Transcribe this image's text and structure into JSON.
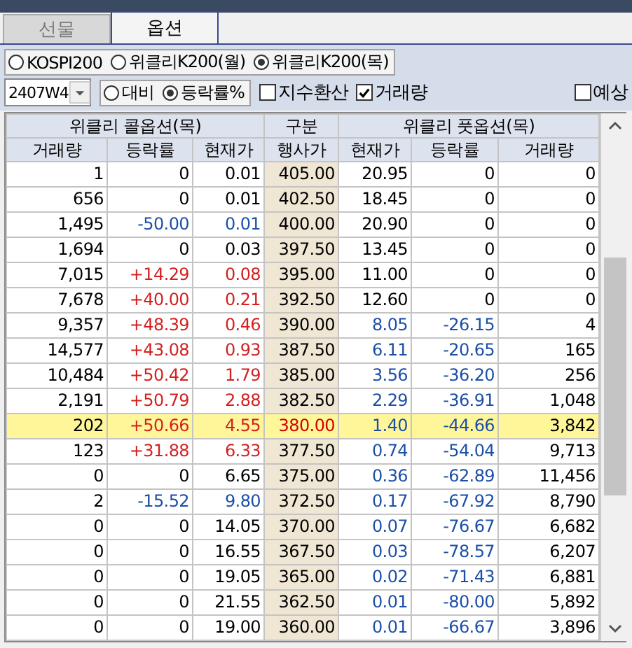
{
  "tabs": [
    {
      "label": "선물",
      "selected": false
    },
    {
      "label": "옵션",
      "selected": true
    }
  ],
  "markets": [
    {
      "label": "KOSPI200",
      "selected": false
    },
    {
      "label": "위클리K200(월)",
      "selected": false
    },
    {
      "label": "위클리K200(목)",
      "selected": true
    }
  ],
  "expiry": {
    "value": "2407W4"
  },
  "display_modes": [
    {
      "label": "대비",
      "selected": false
    },
    {
      "label": "등락률%",
      "selected": true
    }
  ],
  "options": [
    {
      "label": "지수환산",
      "checked": false
    },
    {
      "label": "거래량",
      "checked": true
    }
  ],
  "estimate": {
    "label": "예상",
    "checked": false
  },
  "table": {
    "groups": [
      "위클리 콜옵션(목)",
      "구분",
      "위클리 풋옵션(목)"
    ],
    "columns": [
      "거래량",
      "등락률",
      "현재가",
      "행사가",
      "현재가",
      "등락률",
      "거래량"
    ],
    "rows": [
      {
        "call": {
          "volume": "1",
          "change": "0",
          "price": "0.01",
          "color": "#000000"
        },
        "strike": "405.00",
        "put": {
          "price": "20.95",
          "change": "0",
          "volume": "0",
          "color": "#000000"
        },
        "highlighted": false
      },
      {
        "call": {
          "volume": "656",
          "change": "0",
          "price": "0.01",
          "color": "#000000"
        },
        "strike": "402.50",
        "put": {
          "price": "18.45",
          "change": "0",
          "volume": "0",
          "color": "#000000"
        },
        "highlighted": false
      },
      {
        "call": {
          "volume": "1,495",
          "change": "-50.00",
          "price": "0.01",
          "color": "#1c4fa8"
        },
        "strike": "400.00",
        "put": {
          "price": "20.90",
          "change": "0",
          "volume": "0",
          "color": "#000000"
        },
        "highlighted": false
      },
      {
        "call": {
          "volume": "1,694",
          "change": "0",
          "price": "0.03",
          "color": "#000000"
        },
        "strike": "397.50",
        "put": {
          "price": "13.45",
          "change": "0",
          "volume": "0",
          "color": "#000000"
        },
        "highlighted": false
      },
      {
        "call": {
          "volume": "7,015",
          "change": "+14.29",
          "price": "0.08",
          "color": "#d42020"
        },
        "strike": "395.00",
        "put": {
          "price": "11.00",
          "change": "0",
          "volume": "0",
          "color": "#000000"
        },
        "highlighted": false
      },
      {
        "call": {
          "volume": "7,678",
          "change": "+40.00",
          "price": "0.21",
          "color": "#d42020"
        },
        "strike": "392.50",
        "put": {
          "price": "12.60",
          "change": "0",
          "volume": "0",
          "color": "#000000"
        },
        "highlighted": false
      },
      {
        "call": {
          "volume": "9,357",
          "change": "+48.39",
          "price": "0.46",
          "color": "#d42020"
        },
        "strike": "390.00",
        "put": {
          "price": "8.05",
          "change": "-26.15",
          "volume": "4",
          "color": "#1c4fa8"
        },
        "highlighted": false
      },
      {
        "call": {
          "volume": "14,577",
          "change": "+43.08",
          "price": "0.93",
          "color": "#d42020"
        },
        "strike": "387.50",
        "put": {
          "price": "6.11",
          "change": "-20.65",
          "volume": "165",
          "color": "#1c4fa8"
        },
        "highlighted": false
      },
      {
        "call": {
          "volume": "10,484",
          "change": "+50.42",
          "price": "1.79",
          "color": "#d42020"
        },
        "strike": "385.00",
        "put": {
          "price": "3.56",
          "change": "-36.20",
          "volume": "256",
          "color": "#1c4fa8"
        },
        "highlighted": false
      },
      {
        "call": {
          "volume": "2,191",
          "change": "+50.79",
          "price": "2.88",
          "color": "#d42020"
        },
        "strike": "382.50",
        "put": {
          "price": "2.29",
          "change": "-36.91",
          "volume": "1,048",
          "color": "#1c4fa8"
        },
        "highlighted": false
      },
      {
        "call": {
          "volume": "202",
          "change": "+50.66",
          "price": "4.55",
          "color": "#d42020"
        },
        "strike": "380.00",
        "put": {
          "price": "1.40",
          "change": "-44.66",
          "volume": "3,842",
          "color": "#1c4fa8"
        },
        "highlighted": true
      },
      {
        "call": {
          "volume": "123",
          "change": "+31.88",
          "price": "6.33",
          "color": "#d42020"
        },
        "strike": "377.50",
        "put": {
          "price": "0.74",
          "change": "-54.04",
          "volume": "9,713",
          "color": "#1c4fa8"
        },
        "highlighted": false
      },
      {
        "call": {
          "volume": "0",
          "change": "0",
          "price": "6.65",
          "color": "#000000"
        },
        "strike": "375.00",
        "put": {
          "price": "0.36",
          "change": "-62.89",
          "volume": "11,456",
          "color": "#1c4fa8"
        },
        "highlighted": false
      },
      {
        "call": {
          "volume": "2",
          "change": "-15.52",
          "price": "9.80",
          "color": "#1c4fa8"
        },
        "strike": "372.50",
        "put": {
          "price": "0.17",
          "change": "-67.92",
          "volume": "8,790",
          "color": "#1c4fa8"
        },
        "highlighted": false
      },
      {
        "call": {
          "volume": "0",
          "change": "0",
          "price": "14.05",
          "color": "#000000"
        },
        "strike": "370.00",
        "put": {
          "price": "0.07",
          "change": "-76.67",
          "volume": "6,682",
          "color": "#1c4fa8"
        },
        "highlighted": false
      },
      {
        "call": {
          "volume": "0",
          "change": "0",
          "price": "16.55",
          "color": "#000000"
        },
        "strike": "367.50",
        "put": {
          "price": "0.03",
          "change": "-78.57",
          "volume": "6,207",
          "color": "#1c4fa8"
        },
        "highlighted": false
      },
      {
        "call": {
          "volume": "0",
          "change": "0",
          "price": "19.05",
          "color": "#000000"
        },
        "strike": "365.00",
        "put": {
          "price": "0.02",
          "change": "-71.43",
          "volume": "6,881",
          "color": "#1c4fa8"
        },
        "highlighted": false
      },
      {
        "call": {
          "volume": "0",
          "change": "0",
          "price": "21.55",
          "color": "#000000"
        },
        "strike": "362.50",
        "put": {
          "price": "0.01",
          "change": "-80.00",
          "volume": "5,892",
          "color": "#1c4fa8"
        },
        "highlighted": false
      },
      {
        "call": {
          "volume": "0",
          "change": "0",
          "price": "19.00",
          "color": "#000000"
        },
        "strike": "360.00",
        "put": {
          "price": "0.01",
          "change": "-66.67",
          "volume": "3,896",
          "color": "#1c4fa8"
        },
        "highlighted": false
      }
    ]
  }
}
